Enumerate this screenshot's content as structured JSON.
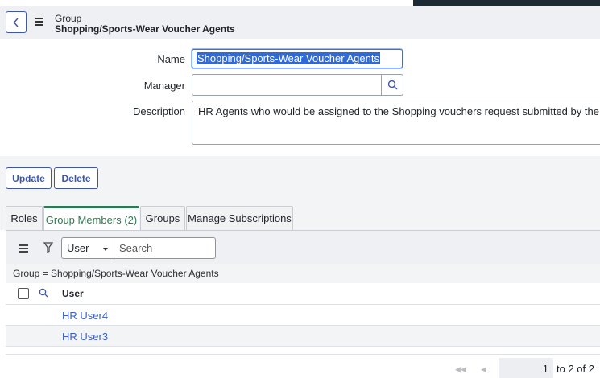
{
  "header": {
    "record_type": "Group",
    "record_name": "Shopping/Sports-Wear Voucher Agents"
  },
  "form": {
    "name_label": "Name",
    "name_value": "Shopping/Sports-Wear Voucher Agents",
    "manager_label": "Manager",
    "manager_value": "",
    "description_label": "Description",
    "description_value": "HR Agents who would be assigned to the Shopping vouchers request submitted by the Managers"
  },
  "actions": {
    "update_label": "Update",
    "delete_label": "Delete"
  },
  "tabs": [
    {
      "label": "Roles"
    },
    {
      "label": "Group Members (2)"
    },
    {
      "label": "Groups"
    },
    {
      "label": "Manage Subscriptions"
    }
  ],
  "list": {
    "field_select": "User",
    "search_placeholder": "Search",
    "breadcrumb": "Group = Shopping/Sports-Wear Voucher Agents",
    "columns": [
      "User"
    ],
    "rows": [
      {
        "user": "HR User4"
      },
      {
        "user": "HR User3"
      }
    ],
    "pagination": {
      "page_value": "1",
      "range_text": "to 2 of 2"
    }
  },
  "colors": {
    "accent": "#3f56a8",
    "active_tab": "#2e7a55",
    "link": "#3b5fc2",
    "selection": "#2f6bd8"
  }
}
